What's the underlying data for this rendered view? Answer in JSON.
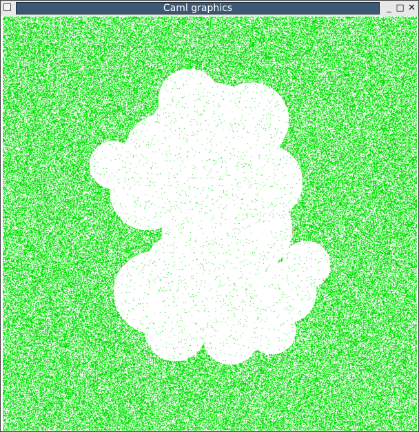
{
  "window": {
    "title": "Caml graphics",
    "controls": {
      "minimize": "_",
      "maximize": "□",
      "close": "✕"
    }
  },
  "canvas": {
    "description": "percolation / growth simulation",
    "colors": {
      "background": "#ffffff",
      "occupied": "#00e000",
      "frontier": "#cc0000"
    },
    "green_fill_fraction": 0.55
  }
}
